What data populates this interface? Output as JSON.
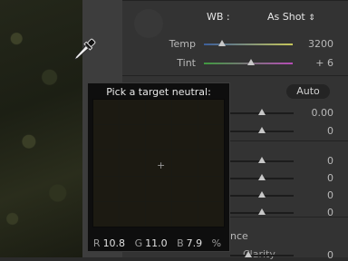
{
  "white_balance": {
    "label": "WB :",
    "value": "As Shot",
    "arrows_glyph": "⇕"
  },
  "temp": {
    "label": "Temp",
    "value": "3200",
    "level": 0.2
  },
  "tint": {
    "label": "Tint",
    "value": "+ 6",
    "level": 0.53
  },
  "tone": {
    "auto_label": "Auto",
    "rows": [
      {
        "value": "0.00",
        "level": 0.5
      },
      {
        "value": "0",
        "level": 0.5
      },
      {
        "value": "0",
        "level": 0.5
      },
      {
        "value": "0",
        "level": 0.5
      },
      {
        "value": "0",
        "level": 0.5
      },
      {
        "value": "0",
        "level": 0.5
      }
    ]
  },
  "presence": {
    "label_partial": "nce",
    "clarity_partial": "Clarity"
  },
  "picker": {
    "title": "Pick a target neutral:",
    "crosshair": "+",
    "r_label": "R",
    "r_value": "10.8",
    "g_label": "G",
    "g_value": "11.0",
    "b_label": "B",
    "b_value": "7.9",
    "unit": "%"
  },
  "colors": {
    "temp_gradient": [
      "#3c5e9a",
      "#c6c65a"
    ],
    "tint_gradient": [
      "#3f9a3f",
      "#b64cb6"
    ]
  },
  "icons": {
    "eyedropper": "eyedropper-icon"
  }
}
